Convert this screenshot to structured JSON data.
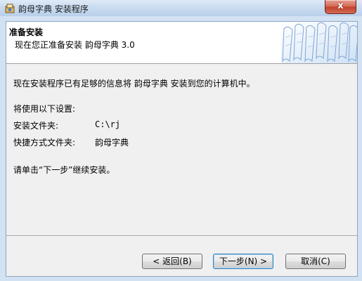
{
  "window": {
    "title": "韵母字典 安装程序",
    "close_label": "x"
  },
  "header": {
    "title": "准备安装",
    "subtitle": "现在您正准备安装 韵母字典 3.0"
  },
  "body": {
    "intro": "现在安装程序已有足够的信息将 韵母字典 安装到您的计算机中。",
    "settings_heading": "将使用以下设置:",
    "install_folder_label": "安装文件夹:",
    "install_folder_value": "C:\\rj",
    "shortcut_folder_label": "快捷方式文件夹:",
    "shortcut_folder_value": "韵母字典",
    "continue_hint": "请单击“下一步”继续安装。"
  },
  "buttons": {
    "back": "< 返回(B)",
    "next": "下一步(N) >",
    "cancel": "取消(C)"
  }
}
